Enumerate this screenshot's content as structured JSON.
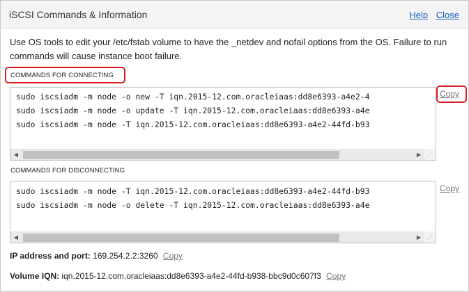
{
  "header": {
    "title": "iSCSI Commands & Information",
    "help_label": "Help",
    "close_label": "Close"
  },
  "intro_text": "Use OS tools to edit your /etc/fstab volume to have the _netdev and nofail options from the OS. Failure to run commands will cause instance boot failure.",
  "connecting": {
    "label": "COMMANDS FOR CONNECTING",
    "commands": [
      "sudo iscsiadm -m node -o new -T iqn.2015-12.com.oracleiaas:dd8e6393-a4e2-4",
      "sudo iscsiadm -m node -o update -T iqn.2015-12.com.oracleiaas:dd8e6393-a4e",
      "sudo iscsiadm -m node -T iqn.2015-12.com.oracleiaas:dd8e6393-a4e2-44fd-b93"
    ],
    "copy_label": "Copy"
  },
  "disconnecting": {
    "label": "COMMANDS FOR DISCONNECTING",
    "commands": [
      "sudo iscsiadm -m node -T iqn.2015-12.com.oracleiaas:dd8e6393-a4e2-44fd-b93",
      "sudo iscsiadm -m node -o delete -T iqn.2015-12.com.oracleiaas:dd8e6393-a4e"
    ],
    "copy_label": "Copy"
  },
  "ip_port": {
    "label": "IP address and port:",
    "value": "169.254.2.2:3260",
    "copy_label": "Copy"
  },
  "volume_iqn": {
    "label": "Volume IQN:",
    "value": "iqn.2015-12.com.oracleiaas:dd8e6393-a4e2-44fd-b938-bbc9d0c607f3",
    "copy_label": "Copy"
  },
  "colors": {
    "link": "#1a5eb8",
    "highlight": "#d81e1e",
    "muted_link": "#777777"
  },
  "icons": {
    "scroll_left": "triangle-left-icon",
    "scroll_right": "triangle-right-icon",
    "resize": "resize-grip-icon"
  }
}
